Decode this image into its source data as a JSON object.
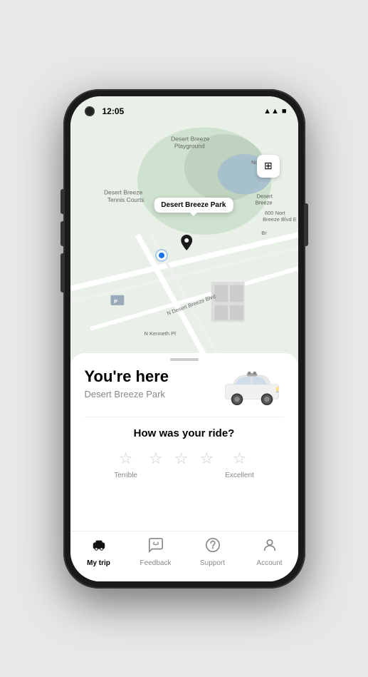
{
  "status_bar": {
    "time": "12:05",
    "signal": "▲▲",
    "battery": "■"
  },
  "map": {
    "tooltip": "Desert Breeze Park",
    "layers_icon": "⊞"
  },
  "panel": {
    "heading": "You're here",
    "location": "Desert Breeze Park",
    "rating_question": "How was your ride?",
    "stars": [
      {
        "label": "Terrible"
      },
      {
        "label": ""
      },
      {
        "label": ""
      },
      {
        "label": ""
      },
      {
        "label": "Excellent"
      }
    ]
  },
  "nav": {
    "items": [
      {
        "id": "my-trip",
        "label": "My trip",
        "active": true
      },
      {
        "id": "feedback",
        "label": "Feedback",
        "active": false
      },
      {
        "id": "support",
        "label": "Support",
        "active": false
      },
      {
        "id": "account",
        "label": "Account",
        "active": false
      }
    ]
  }
}
